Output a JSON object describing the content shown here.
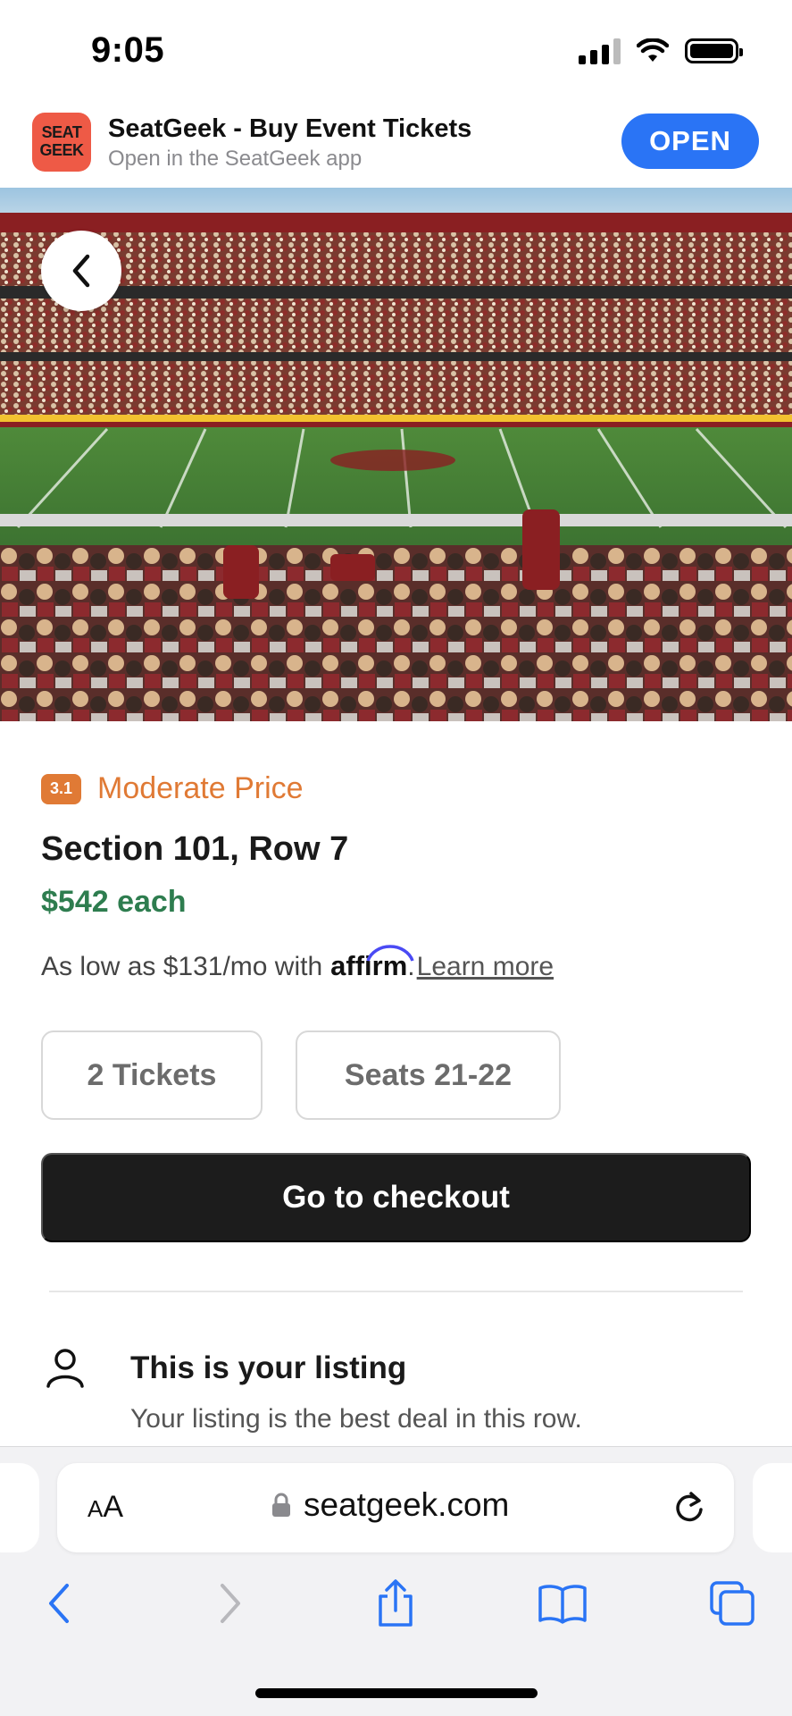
{
  "status_bar": {
    "time": "9:05",
    "icons": [
      "signal-icon",
      "wifi-icon",
      "battery-icon"
    ]
  },
  "app_banner": {
    "logo_text": "SEAT GEEK",
    "title": "SeatGeek - Buy Event Tickets",
    "subtitle": "Open in the SeatGeek app",
    "open_label": "OPEN",
    "accent_color": "#2a74f5"
  },
  "listing": {
    "rating": "3.1",
    "rating_label": "Moderate Price",
    "rating_color": "#e07a35",
    "section_row": "Section 101, Row 7",
    "price": "$542 each",
    "price_color": "#2e7d4f",
    "affirm_prefix": "As low as $131/mo with",
    "affirm_brand": "affirm",
    "affirm_suffix": ".",
    "learn_more": "Learn more",
    "tickets_label": "2 Tickets",
    "seats_label": "Seats 21-22",
    "checkout_label": "Go to checkout",
    "your_listing_title": "This is your listing",
    "your_listing_sub": "Your listing is the best deal in this row."
  },
  "browser": {
    "text_size_label_small": "A",
    "text_size_label_large": "A",
    "url": "seatgeek.com",
    "nav_icons": [
      "back-icon",
      "forward-icon",
      "share-icon",
      "bookmarks-icon",
      "tabs-icon"
    ]
  }
}
